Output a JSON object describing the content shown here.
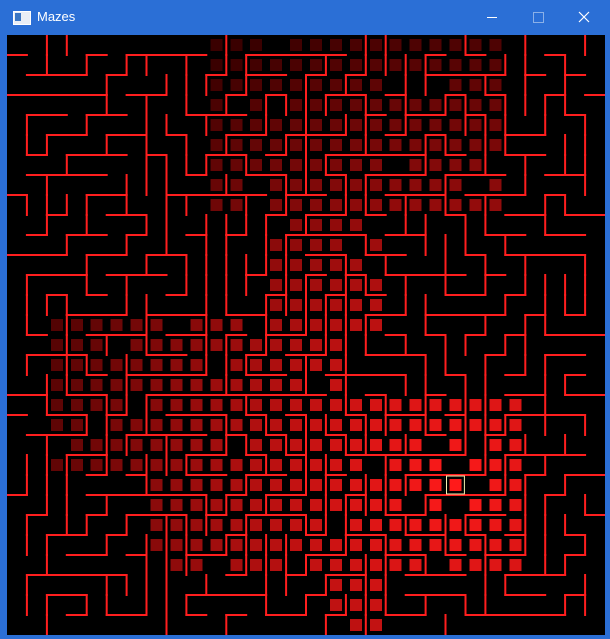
{
  "window": {
    "title": "Mazes",
    "controls": [
      "minimize",
      "maximize",
      "close"
    ]
  },
  "colors": {
    "background": "#000000",
    "wall": "#ff1e1e",
    "trail_bright": "#ff1a1a",
    "trail_dark": "#3a0000",
    "current_cell_outline": "#f3f0b0",
    "titlebar": "#2b6fd6"
  },
  "maze": {
    "cols": 30,
    "rows": 30,
    "seed": 7,
    "current_cell": [
      22,
      22
    ]
  }
}
